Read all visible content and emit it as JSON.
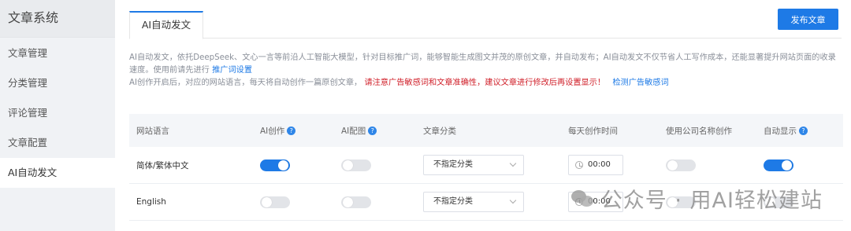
{
  "sidebar": {
    "title": "文章系统",
    "items": [
      {
        "label": "文章管理"
      },
      {
        "label": "分类管理"
      },
      {
        "label": "评论管理"
      },
      {
        "label": "文章配置"
      },
      {
        "label": "AI自动发文"
      }
    ]
  },
  "tab": {
    "label": "AI自动发文"
  },
  "publish_button": "发布文章",
  "description": {
    "line1": "AI自动发文，依托DeepSeek、文心一言等前沿人工智能大模型，针对目标推广词，能够智能生成图文并茂的原创文章，并自动发布；AI自动发文不仅节省人工写作成本，还能显著提升网站页面的收录",
    "line2_prefix": "速度。使用前请先进行",
    "line2_link": "推广词设置",
    "line3_prefix": "AI创作开启后，对应的网站语言，每天将自动创作一篇原创文章，",
    "line3_warning": "请注意广告敏感词和文章准确性，建议文章进行修改后再设置显示！",
    "line3_link": "检测广告敏感词"
  },
  "table": {
    "headers": {
      "language": "网站语言",
      "ai_create": "AI创作",
      "ai_image": "AI配图",
      "category": "文章分类",
      "daily_time": "每天创作时间",
      "company_name": "使用公司名称创作",
      "auto_show": "自动显示"
    },
    "help_icon_char": "?",
    "rows": [
      {
        "language": "简体/繁体中文",
        "ai_create": true,
        "ai_image": false,
        "category": "不指定分类",
        "time": "00:00",
        "company_name": false,
        "auto_show": true
      },
      {
        "language": "English",
        "ai_create": false,
        "ai_image": false,
        "category": "不指定分类",
        "time": "00:00",
        "company_name": false,
        "auto_show": false
      }
    ]
  },
  "watermark": "公众号 · 用AI轻松建站",
  "colors": {
    "accent": "#1e7ae6",
    "warning": "#d0202a",
    "sidebar_bg": "#f0f2f5"
  }
}
